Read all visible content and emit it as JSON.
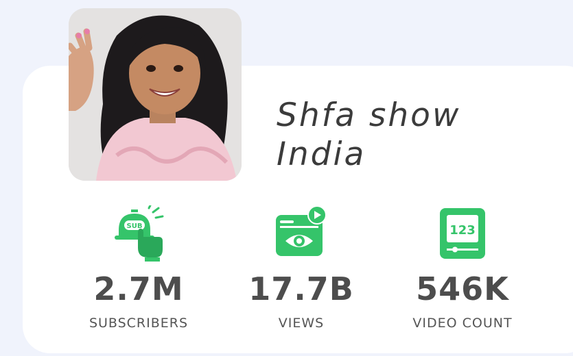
{
  "channel": {
    "name": "Shfa show India"
  },
  "stats": [
    {
      "icon": "subscribe-bell-icon",
      "value": "2.7M",
      "label": "SUBSCRIBERS"
    },
    {
      "icon": "video-views-icon",
      "value": "17.7B",
      "label": "VIEWS"
    },
    {
      "icon": "video-count-icon",
      "value": "546K",
      "label": "VIDEO COUNT"
    }
  ],
  "colors": {
    "accent": "#35c46a",
    "background": "#f0f3fc",
    "card": "#ffffff",
    "value_text": "#4d4d4d"
  }
}
